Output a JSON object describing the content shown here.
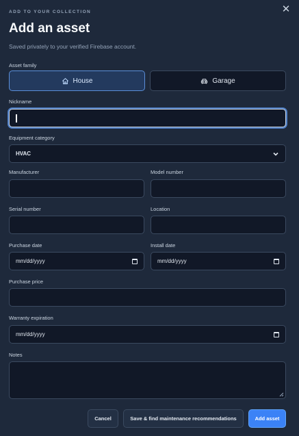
{
  "dialog": {
    "eyebrow": "ADD TO YOUR COLLECTION",
    "title": "Add an asset",
    "subtitle": "Saved privately to your verified Firebase account.",
    "close_icon": "close-icon"
  },
  "asset_family": {
    "label": "Asset family",
    "options": [
      {
        "label": "House",
        "icon": "house-icon",
        "selected": true
      },
      {
        "label": "Garage",
        "icon": "car-icon",
        "selected": false
      }
    ]
  },
  "fields": {
    "nickname": {
      "label": "Nickname",
      "value": ""
    },
    "equipment_category": {
      "label": "Equipment category",
      "value": "HVAC"
    },
    "manufacturer": {
      "label": "Manufacturer",
      "value": ""
    },
    "model_number": {
      "label": "Model number",
      "value": ""
    },
    "serial_number": {
      "label": "Serial number",
      "value": ""
    },
    "location": {
      "label": "Location",
      "value": ""
    },
    "purchase_date": {
      "label": "Purchase date",
      "placeholder": "mm/dd/yyyy"
    },
    "install_date": {
      "label": "Install date",
      "placeholder": "mm/dd/yyyy"
    },
    "purchase_price": {
      "label": "Purchase price",
      "value": ""
    },
    "warranty_expiration": {
      "label": "Warranty expiration",
      "placeholder": "mm/dd/yyyy"
    },
    "notes": {
      "label": "Notes",
      "value": ""
    }
  },
  "actions": {
    "cancel": "Cancel",
    "save_find": "Save & find maintenance recommendations",
    "add": "Add asset"
  },
  "colors": {
    "background": "#1e293b",
    "input_bg": "#111827",
    "accent": "#3b82f6",
    "selected_segment": "#233a5e"
  }
}
